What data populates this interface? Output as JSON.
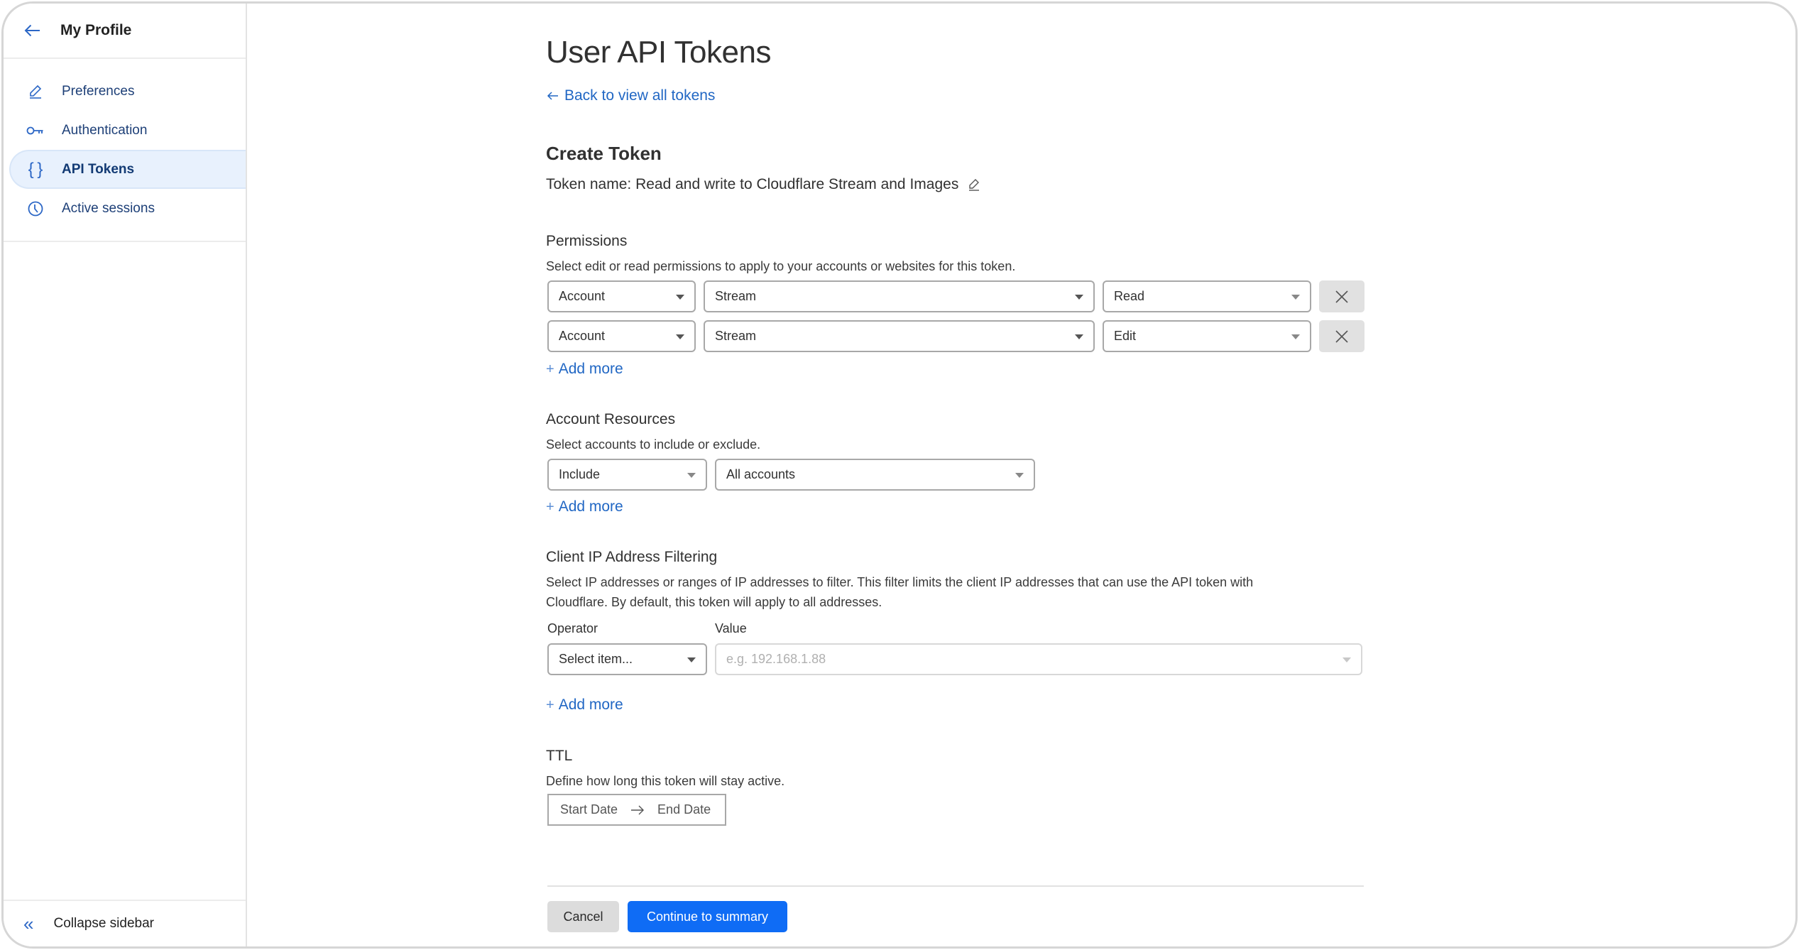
{
  "sidebar": {
    "title": "My Profile",
    "items": [
      {
        "label": "Preferences",
        "icon": "pencil-icon",
        "active": false
      },
      {
        "label": "Authentication",
        "icon": "key-icon",
        "active": false
      },
      {
        "label": "API Tokens",
        "icon": "braces-icon",
        "active": true
      },
      {
        "label": "Active sessions",
        "icon": "clock-icon",
        "active": false
      }
    ],
    "collapse_label": "Collapse sidebar"
  },
  "main": {
    "page_title": "User API Tokens",
    "back_link": "Back to view all tokens",
    "section_title": "Create Token",
    "token_name": "Token name: Read and write to Cloudflare Stream and Images",
    "permissions": {
      "title": "Permissions",
      "description": "Select edit or read permissions to apply to your accounts or websites for this token.",
      "rows": [
        {
          "scope": "Account",
          "resource": "Stream",
          "access": "Read"
        },
        {
          "scope": "Account",
          "resource": "Stream",
          "access": "Edit"
        }
      ],
      "add_more": "Add more"
    },
    "account_resources": {
      "title": "Account Resources",
      "description": "Select accounts to include or exclude.",
      "mode": "Include",
      "accounts": "All accounts",
      "add_more": "Add more"
    },
    "ip_filtering": {
      "title": "Client IP Address Filtering",
      "description_line1": "Select IP addresses or ranges of IP addresses to filter. This filter limits the client IP addresses that can use the API token with",
      "description_line2": "Cloudflare. By default, this token will apply to all addresses.",
      "operator_label": "Operator",
      "value_label": "Value",
      "operator_placeholder": "Select item...",
      "value_placeholder": "e.g. 192.168.1.88",
      "add_more": "Add more"
    },
    "ttl": {
      "title": "TTL",
      "description": "Define how long this token will stay active.",
      "start_placeholder": "Start Date",
      "end_placeholder": "End Date"
    },
    "actions": {
      "cancel": "Cancel",
      "continue": "Continue to summary"
    }
  },
  "colors": {
    "accent": "#2167c4",
    "primary_button": "#0f6cf5",
    "active_nav_bg": "#e8f1fd"
  }
}
